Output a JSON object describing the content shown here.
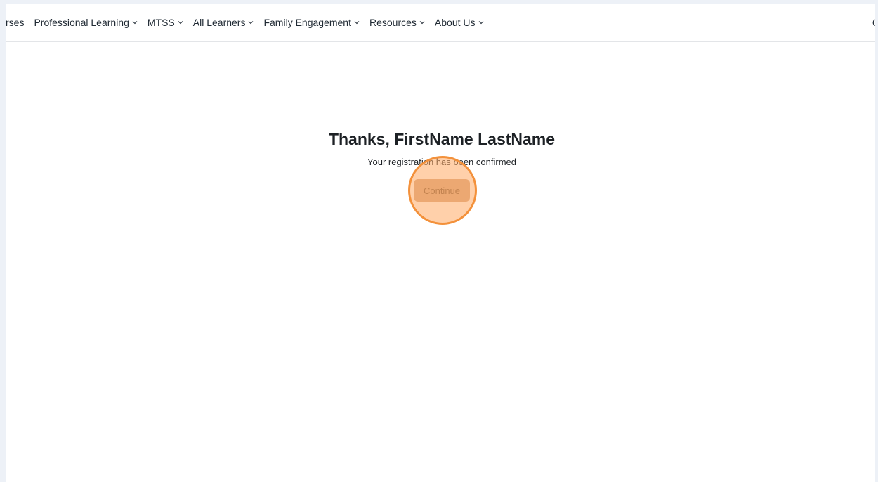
{
  "nav": {
    "items": [
      {
        "label": "rses",
        "has_dropdown": false
      },
      {
        "label": "Professional Learning",
        "has_dropdown": true
      },
      {
        "label": "MTSS",
        "has_dropdown": true
      },
      {
        "label": "All Learners",
        "has_dropdown": true
      },
      {
        "label": "Family Engagement",
        "has_dropdown": true
      },
      {
        "label": "Resources",
        "has_dropdown": true
      },
      {
        "label": "About Us",
        "has_dropdown": true
      }
    ],
    "right_partial_text": "C",
    "dropdown_icon": "chevron-down-icon"
  },
  "confirmation": {
    "title": "Thanks, FirstName LastName",
    "message": "Your registration has been confirmed",
    "continue_label": "Continue"
  },
  "colors": {
    "button_bg": "#d5a783",
    "button_text": "#7a5638",
    "click_highlight_ring": "#f3913b",
    "page_bg": "#ffffff",
    "outer_bg": "#edf1f7"
  }
}
